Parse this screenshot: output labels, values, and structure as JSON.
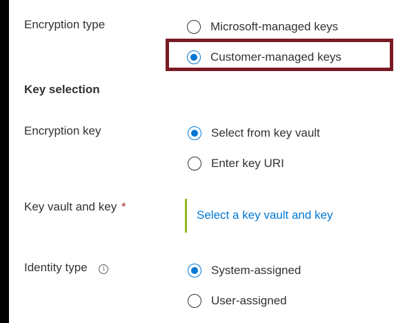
{
  "encryption_type": {
    "label": "Encryption type",
    "options": [
      {
        "label": "Microsoft-managed keys",
        "selected": false
      },
      {
        "label": "Customer-managed keys",
        "selected": true
      }
    ],
    "highlight_color": "#7a1a24"
  },
  "key_selection": {
    "title": "Key selection"
  },
  "encryption_key": {
    "label": "Encryption key",
    "options": [
      {
        "label": "Select from key vault",
        "selected": true
      },
      {
        "label": "Enter key URI",
        "selected": false
      }
    ]
  },
  "key_vault": {
    "label": "Key vault and key",
    "required_marker": "*",
    "link_text": "Select a key vault and key"
  },
  "identity_type": {
    "label": "Identity type",
    "info_icon": "info-icon",
    "info_glyph": "i",
    "options": [
      {
        "label": "System-assigned",
        "selected": true
      },
      {
        "label": "User-assigned",
        "selected": false
      }
    ]
  },
  "colors": {
    "accent": "#0078d4",
    "text": "#323130",
    "required": "#a4262c",
    "picker_bar": "#8cbd18"
  }
}
